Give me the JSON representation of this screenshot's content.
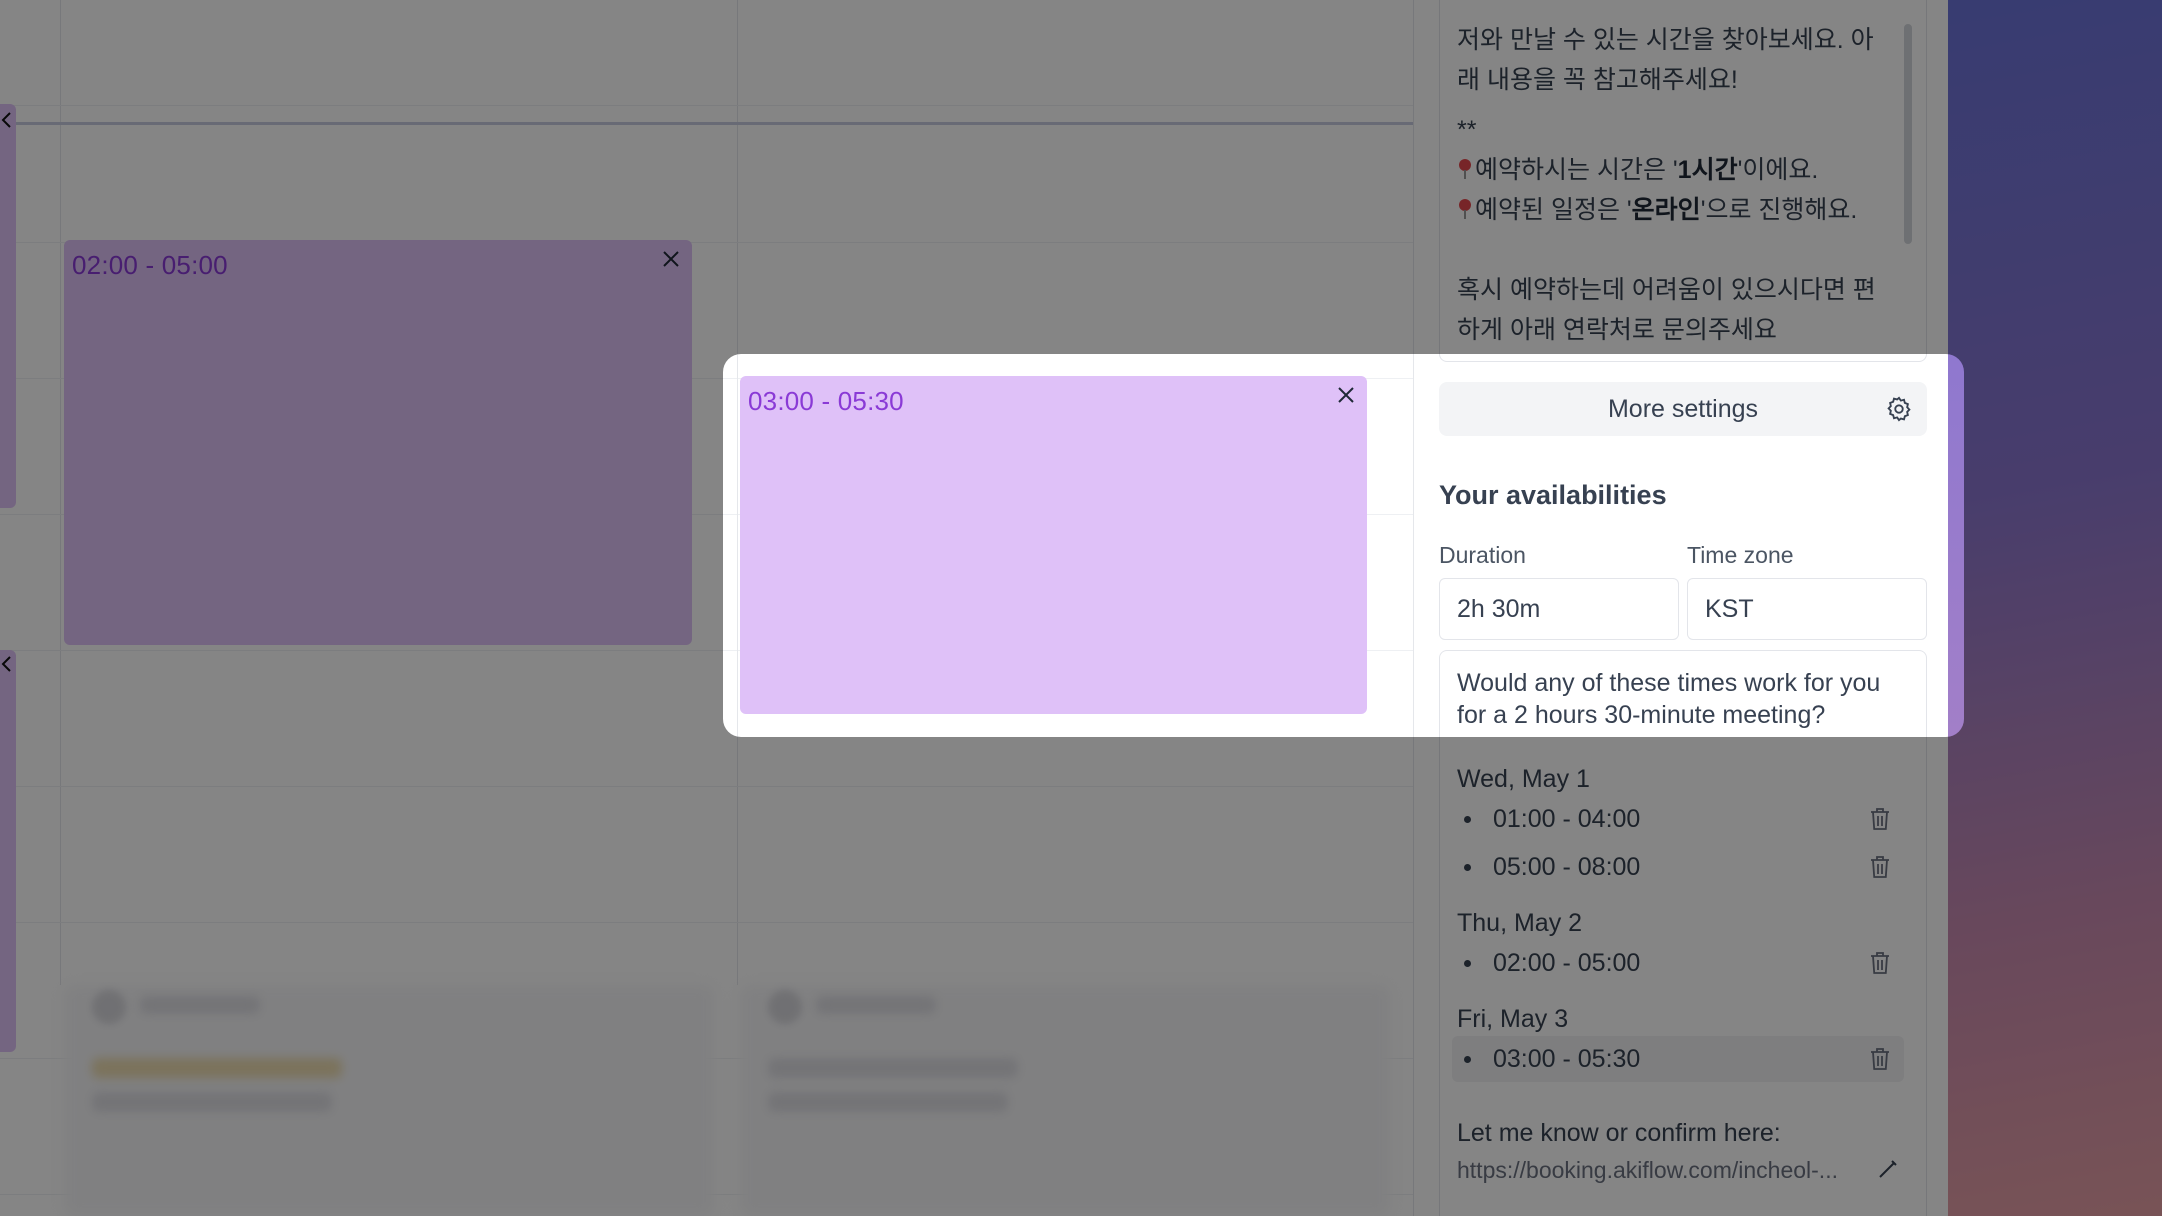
{
  "calendar": {
    "events": [
      {
        "time": "02:00 - 05:00",
        "state": "dimmed"
      },
      {
        "time": "03:00 - 05:30",
        "state": "focused"
      }
    ]
  },
  "description": {
    "line1": "저와 만날 수 있는 시간을 찾아보세요. 아",
    "line2": "래 내용을 꼭 참고해주세요!",
    "line3": "**",
    "bullet1_prefix": "예약하시는 시간은 '",
    "bullet1_bold": "1시간",
    "bullet1_suffix": "'이에요.",
    "bullet2_prefix": "예약된 일정은 '",
    "bullet2_bold": "온라인",
    "bullet2_suffix": "'으로 진행해요.",
    "line4": "혹시 예약하는데 어려움이 있으시다면 편",
    "line5": "하게 아래 연락처로 문의주세요"
  },
  "settings": {
    "more_label": "More settings"
  },
  "availabilities": {
    "title": "Your availabilities",
    "duration_label": "Duration",
    "duration_value": "2h 30m",
    "timezone_label": "Time zone",
    "timezone_value": "KST",
    "intro": "Would any of these times work for you for a 2 hours 30-minute meeting?",
    "days": [
      {
        "label": "Wed, May 1",
        "slots": [
          "01:00 - 04:00",
          "05:00 - 08:00"
        ]
      },
      {
        "label": "Thu, May 2",
        "slots": [
          "02:00 - 05:00"
        ]
      },
      {
        "label": "Fri, May 3",
        "slots": [
          "03:00 - 05:30"
        ]
      }
    ],
    "confirm_text": "Let me know or confirm here:",
    "confirm_link": "https://booking.akiflow.com/incheol-..."
  },
  "colors": {
    "event_fill": "#dfc1f8",
    "event_text": "#8a3ad6",
    "overlay": "rgba(0,0,0,0.48)"
  }
}
